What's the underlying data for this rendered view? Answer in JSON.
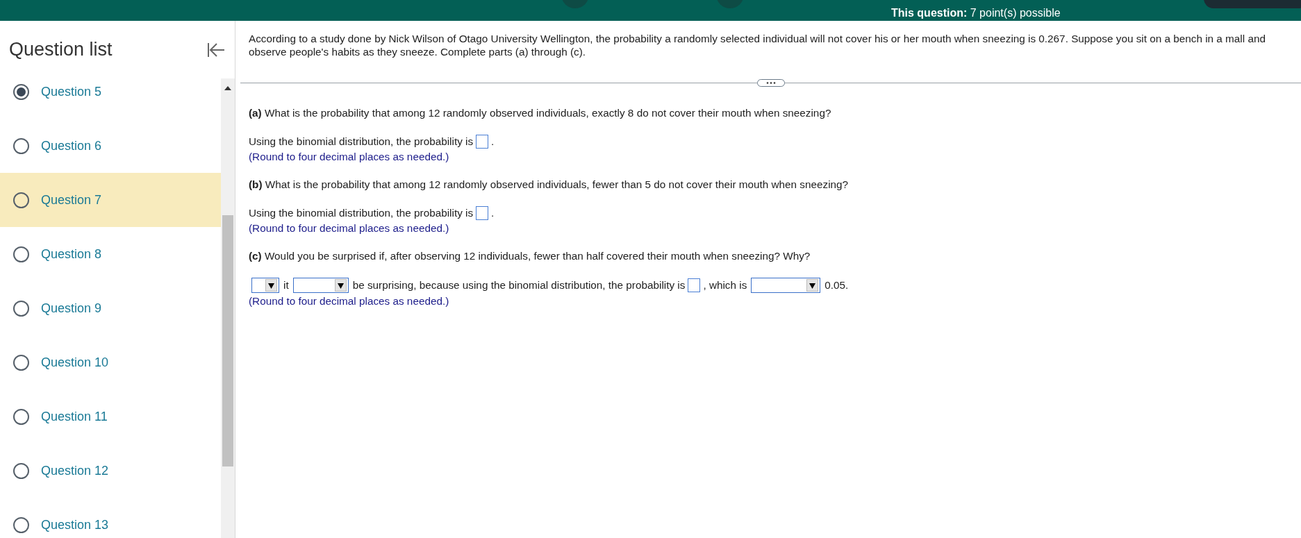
{
  "header": {
    "points": "**This question:** 7 point(s) possible"
  },
  "sidebar": {
    "title": "Question list",
    "items": [
      {
        "label": "Question 5",
        "checked": true,
        "selected": false
      },
      {
        "label": "Question 6",
        "checked": false,
        "selected": false
      },
      {
        "label": "Question 7",
        "checked": false,
        "selected": true
      },
      {
        "label": "Question 8",
        "checked": false,
        "selected": false
      },
      {
        "label": "Question 9",
        "checked": false,
        "selected": false
      },
      {
        "label": "Question 10",
        "checked": false,
        "selected": false
      },
      {
        "label": "Question 11",
        "checked": false,
        "selected": false
      },
      {
        "label": "Question 12",
        "checked": false,
        "selected": false
      },
      {
        "label": "Question 13",
        "checked": false,
        "selected": false
      }
    ]
  },
  "question": {
    "intro": "According to a study done by Nick Wilson of Otago University Wellington, the probability a randomly selected individual will not cover his or her mouth when sneezing is 0.267. Suppose you sit on a bench in a mall and observe people's habits as they sneeze. Complete parts (a) through (c).",
    "parts": [
      {
        "question": "**(a)** What is the probability that among 12 randomly observed individuals, exactly 8 do not cover their mouth when sneezing?",
        "answer": [
          {
            "kind": "text",
            "text": "Using the binomial distribution, the probability is"
          },
          {
            "kind": "blank"
          },
          {
            "kind": "text",
            "text": "."
          }
        ],
        "note": "(Round to four decimal places as needed.)"
      },
      {
        "question": "**(b)** What is the probability that among 12 randomly observed individuals, fewer than 5 do not cover their mouth when sneezing?",
        "answer": [
          {
            "kind": "text",
            "text": "Using the binomial distribution, the probability is"
          },
          {
            "kind": "blank"
          },
          {
            "kind": "text",
            "text": "."
          }
        ],
        "note": "(Round to four decimal places as needed.)"
      },
      {
        "question": "**(c)** Would you be surprised if, after observing 12 individuals, fewer than half covered their mouth when sneezing? Why?",
        "answer": [
          {
            "kind": "dropdown"
          },
          {
            "kind": "text",
            "text": "it"
          },
          {
            "kind": "dropdown"
          },
          {
            "kind": "text",
            "text": "be surprising, because using the binomial distribution, the probability is"
          },
          {
            "kind": "blank"
          },
          {
            "kind": "text",
            "text": ", which is"
          },
          {
            "kind": "dropdown"
          },
          {
            "kind": "text",
            "text": "0.05."
          }
        ],
        "note": "(Round to four decimal places as needed.)"
      }
    ]
  }
}
